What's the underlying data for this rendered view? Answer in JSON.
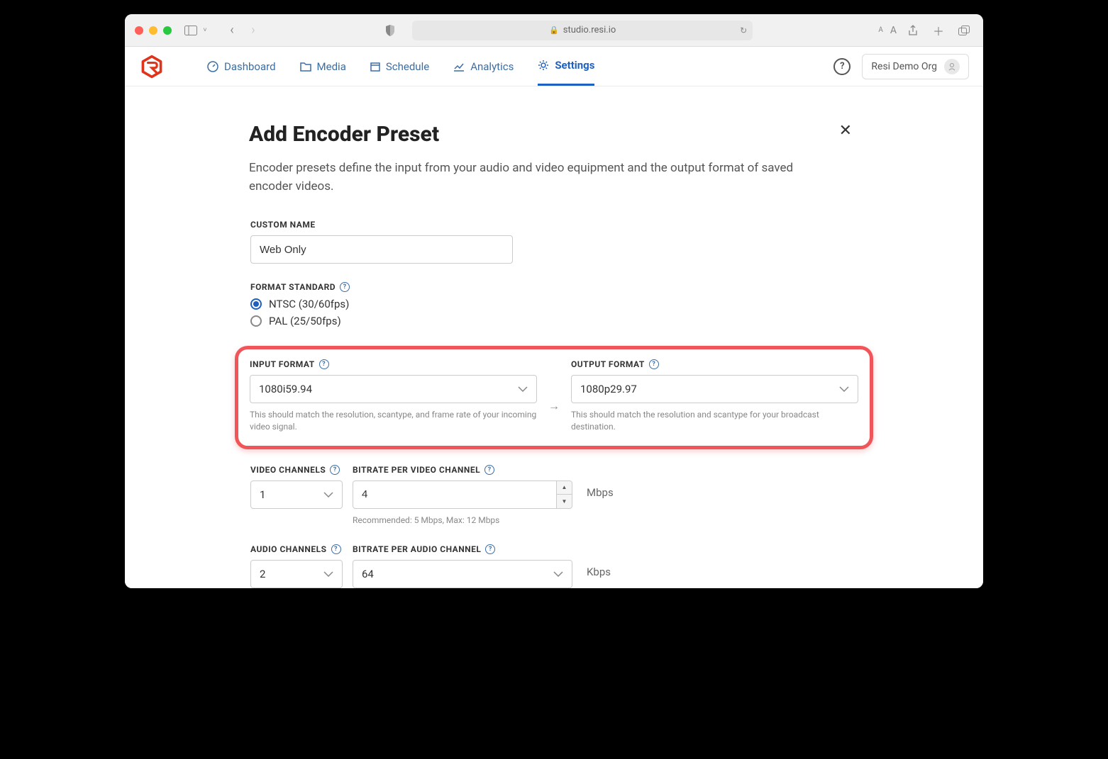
{
  "browser": {
    "url": "studio.resi.io",
    "font_small": "A",
    "font_large": "A"
  },
  "nav": {
    "items": [
      {
        "label": "Dashboard",
        "icon": "gauge"
      },
      {
        "label": "Media",
        "icon": "folder"
      },
      {
        "label": "Schedule",
        "icon": "calendar"
      },
      {
        "label": "Analytics",
        "icon": "chart"
      },
      {
        "label": "Settings",
        "icon": "gear",
        "active": true
      }
    ],
    "org_name": "Resi Demo Org"
  },
  "page": {
    "title": "Add Encoder Preset",
    "description": "Encoder presets define the input from your audio and video equipment and the output format of saved encoder videos."
  },
  "form": {
    "custom_name": {
      "label": "Custom Name",
      "value": "Web Only"
    },
    "format_standard": {
      "label": "Format Standard",
      "options": [
        {
          "label": "NTSC (30/60fps)",
          "selected": true
        },
        {
          "label": "PAL (25/50fps)",
          "selected": false
        }
      ]
    },
    "input_format": {
      "label": "Input Format",
      "value": "1080i59.94",
      "hint": "This should match the resolution, scantype, and frame rate of your incoming video signal."
    },
    "output_format": {
      "label": "Output Format",
      "value": "1080p29.97",
      "hint": "This should match the resolution and scantype for your broadcast destination."
    },
    "video_channels": {
      "label": "Video Channels",
      "value": "1"
    },
    "bitrate_video": {
      "label": "Bitrate per Video Channel",
      "value": "4",
      "unit": "Mbps",
      "hint": "Recommended: 5 Mbps, Max: 12 Mbps"
    },
    "audio_channels": {
      "label": "Audio Channels",
      "value": "2"
    },
    "bitrate_audio": {
      "label": "Bitrate per Audio Channel",
      "value": "64",
      "unit": "Kbps"
    }
  }
}
